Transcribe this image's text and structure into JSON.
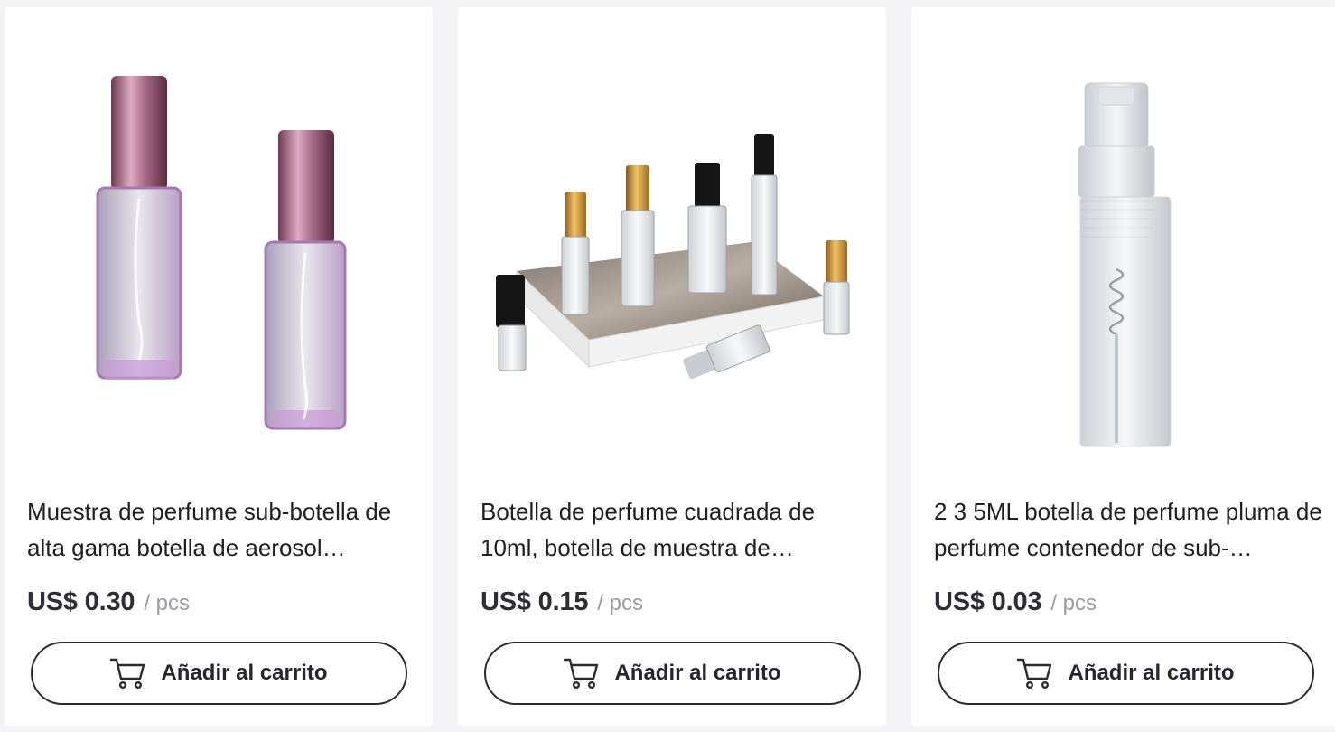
{
  "products": [
    {
      "image_alt": "pink-square-perfume-bottles",
      "title": "Muestra de perfume sub-botella de alta gama botella de aerosol…",
      "price": "US$ 0.30",
      "unit": "/ pcs",
      "cart_label": "Añadir al carrito"
    },
    {
      "image_alt": "square-glass-perfume-bottles-set",
      "title": "Botella de perfume cuadrada de 10ml, botella de muestra de…",
      "price": "US$ 0.15",
      "unit": "/ pcs",
      "cart_label": "Añadir al carrito"
    },
    {
      "image_alt": "clear-perfume-pen-sprayer",
      "title": "2 3 5ML botella de perfume pluma de perfume contenedor de sub-…",
      "price": "US$ 0.03",
      "unit": "/ pcs",
      "cart_label": "Añadir al carrito"
    }
  ],
  "icons": {
    "cart": "shopping-cart-icon"
  },
  "colors": {
    "page_bg": "#f3f3f5",
    "card_bg": "#ffffff",
    "title_text": "#1f1f24",
    "price_text": "#2d2d33",
    "unit_text": "#9a9ca3",
    "button_border": "#2a2a30"
  }
}
